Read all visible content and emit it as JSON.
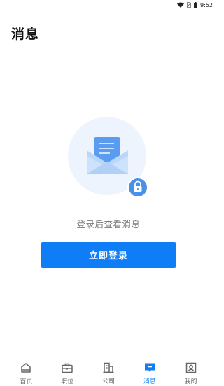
{
  "status_bar": {
    "time": "9:52"
  },
  "page_title": "消息",
  "empty_state": {
    "prompt": "登录后查看消息",
    "illustration_icon": "envelope-lock-icon"
  },
  "login_button_label": "立即登录",
  "nav": {
    "items": [
      {
        "label": "首页",
        "icon": "home-icon",
        "active": false
      },
      {
        "label": "职位",
        "icon": "briefcase-icon",
        "active": false
      },
      {
        "label": "公司",
        "icon": "building-icon",
        "active": false
      },
      {
        "label": "消息",
        "icon": "message-icon",
        "active": true
      },
      {
        "label": "我的",
        "icon": "profile-icon",
        "active": false
      }
    ]
  },
  "colors": {
    "accent": "#0f7ef6",
    "illustration_bg": "#eef4fd",
    "inactive_text": "#666666"
  }
}
